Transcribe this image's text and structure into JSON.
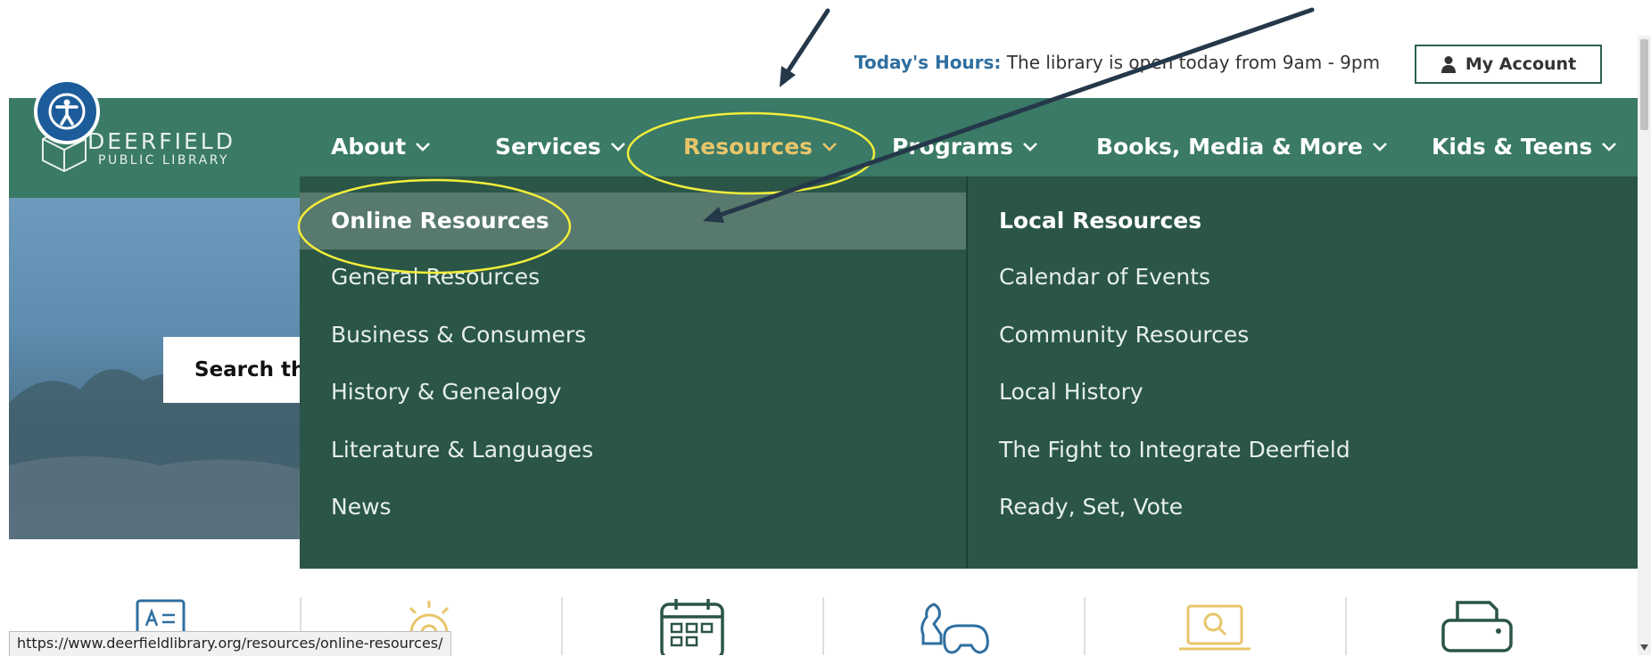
{
  "top_bar": {
    "hours_label": "Today's Hours:",
    "hours_text": "The library is open today from 9am - 9pm",
    "account_label": "My Account"
  },
  "logo": {
    "line1": "DEERFIELD",
    "line2": "PUBLIC LIBRARY"
  },
  "nav": {
    "items": [
      {
        "label": "About"
      },
      {
        "label": "Services"
      },
      {
        "label": "Resources"
      },
      {
        "label": "Programs"
      },
      {
        "label": "Books, Media & More"
      },
      {
        "label": "Kids & Teens"
      }
    ],
    "active": "Resources"
  },
  "hero": {
    "search_label": "Search th"
  },
  "dropdown": {
    "left": {
      "heading": "Online Resources",
      "links": [
        "General Resources",
        "Business & Consumers",
        "History & Genealogy",
        "Literature & Languages",
        "News"
      ]
    },
    "right": {
      "heading": "Local Resources",
      "links": [
        "Calendar of Events",
        "Community Resources",
        "Local History",
        "The Fight to Integrate Deerfield",
        "Ready, Set, Vote"
      ]
    }
  },
  "status_bar": {
    "url": "https://www.deerfieldlibrary.org/resources/online-resources/"
  },
  "icons": [
    "card-icon",
    "gear-lightbulb-icon",
    "calendar-icon",
    "chess-gamepad-icon",
    "laptop-search-icon",
    "printer-icon"
  ],
  "colors": {
    "nav_bg": "#3a7a66",
    "dropdown_bg": "#2a5547",
    "active_nav": "#e8c56a",
    "highlight_row": "#58796d",
    "annotation_ellipse": "#f2ee3a",
    "annotation_arrow": "#25384a",
    "accessibility_blue": "#1c5c9a"
  }
}
